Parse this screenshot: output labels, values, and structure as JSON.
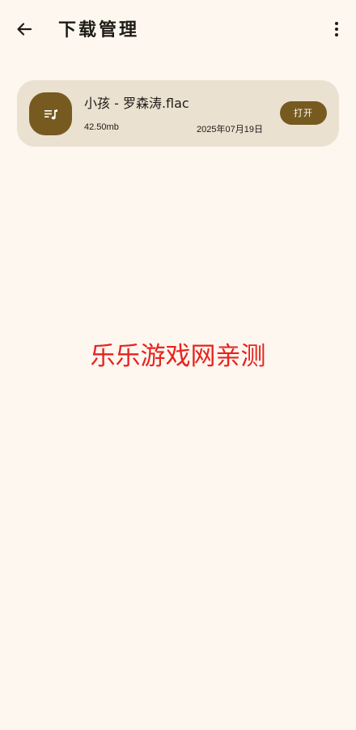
{
  "header": {
    "title": "下载管理",
    "back_icon": "arrow-left-icon",
    "more_icon": "more-vertical-icon"
  },
  "downloads": [
    {
      "icon": "music-playlist-icon",
      "file_name": "小孩 - 罗森涛.flac",
      "size": "42.50mb",
      "date": "2025年07月19日",
      "open_label": "打开"
    }
  ],
  "watermark": "乐乐游戏网亲测",
  "colors": {
    "background": "#fdf7f0",
    "card": "#ebe1d1",
    "accent": "#765a1f",
    "watermark": "#e8231f"
  }
}
